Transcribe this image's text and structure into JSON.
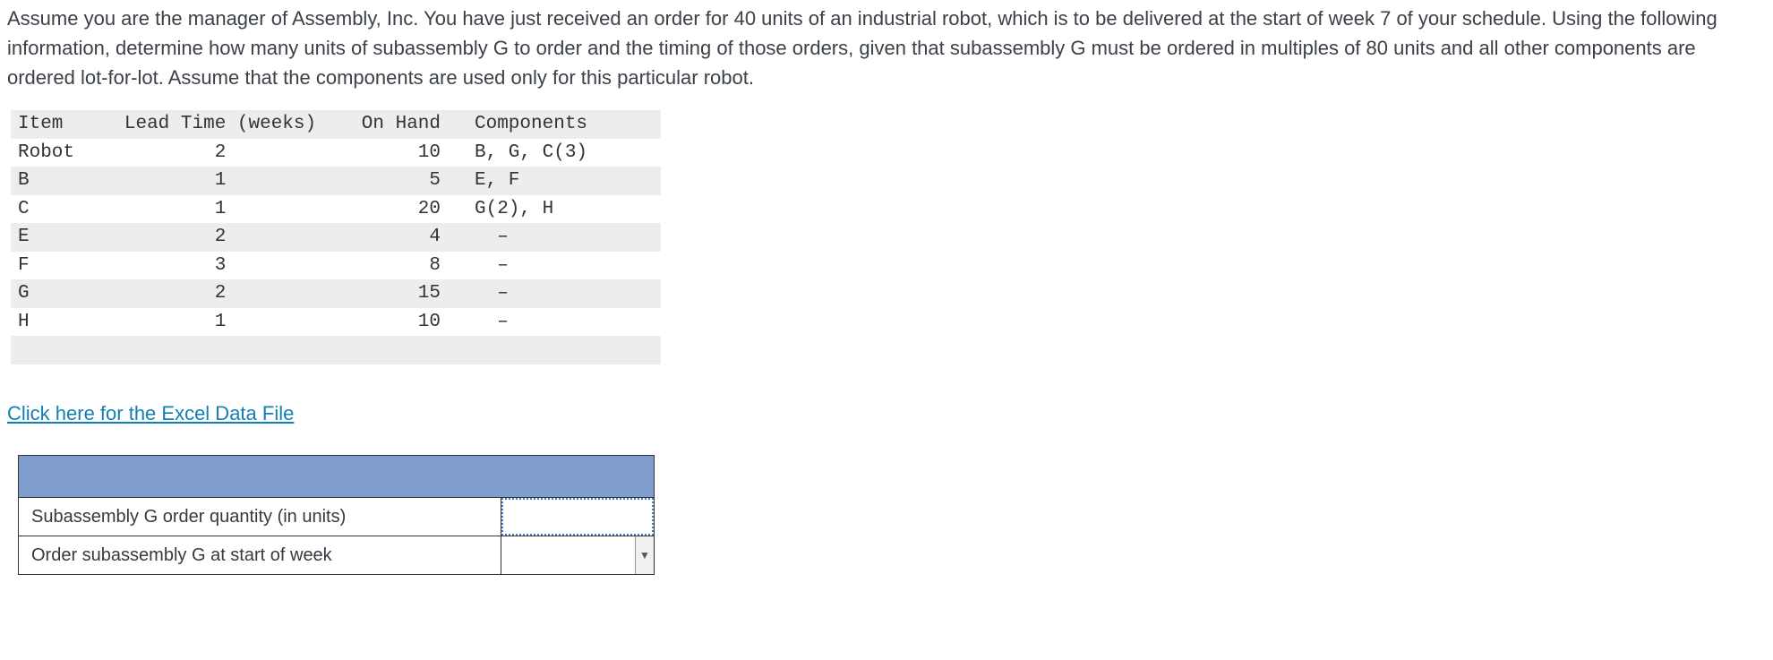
{
  "question": "Assume you are the manager of Assembly, Inc. You have just received an order for 40 units of an industrial robot, which is to be delivered at the start of week 7 of your schedule. Using the following information, determine how many units of subassembly G to order and the timing of those orders, given that subassembly G must be ordered in multiples of 80 units and all other components are ordered lot-for-lot. Assume that the components are used only for this particular robot.",
  "table": {
    "headers": {
      "item": "Item",
      "lt": "Lead Time (weeks)",
      "oh": "On Hand",
      "comp": "Components"
    },
    "rows": [
      {
        "item": "Robot",
        "lt": "2",
        "oh": "10",
        "comp": "B, G, C(3)"
      },
      {
        "item": "B",
        "lt": "1",
        "oh": "5",
        "comp": "E, F"
      },
      {
        "item": "C",
        "lt": "1",
        "oh": "20",
        "comp": "G(2), H"
      },
      {
        "item": "E",
        "lt": "2",
        "oh": "4",
        "comp": "  –"
      },
      {
        "item": "F",
        "lt": "3",
        "oh": "8",
        "comp": "  –"
      },
      {
        "item": "G",
        "lt": "2",
        "oh": "15",
        "comp": "  –"
      },
      {
        "item": "H",
        "lt": "1",
        "oh": "10",
        "comp": "  –"
      }
    ]
  },
  "link_text": "Click here for the Excel Data File",
  "answer_rows": {
    "r1": "Subassembly G order quantity (in units)",
    "r2": "Order subassembly G at start of week"
  }
}
